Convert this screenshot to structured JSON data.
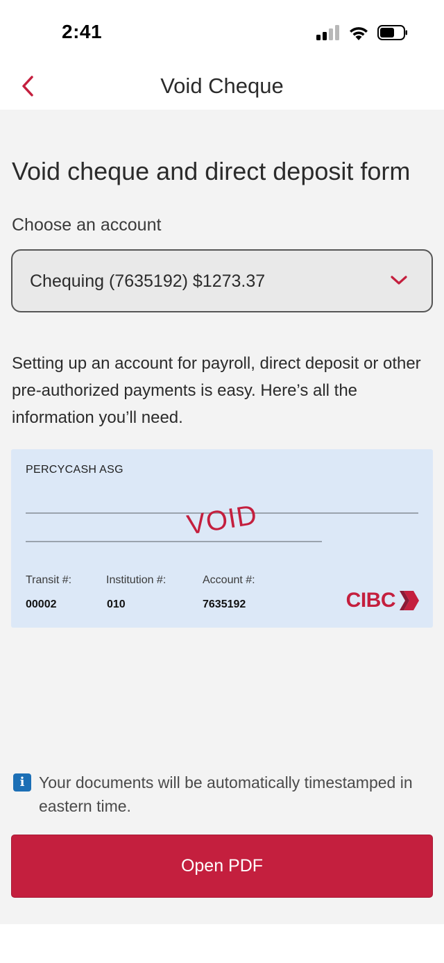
{
  "status_bar": {
    "time": "2:41"
  },
  "nav": {
    "title": "Void Cheque"
  },
  "page": {
    "heading": "Void cheque and direct deposit form",
    "choose_label": "Choose an account",
    "selected_account": "Chequing (7635192) $1273.37",
    "info_text": "Setting up an account for payroll, direct deposit or other pre-authorized payments is easy. Here’s all the information you’ll need."
  },
  "cheque": {
    "holder_name": "PERCYCASH ASG",
    "stamp": "VOID",
    "transit_label": "Transit #:",
    "transit_value": "00002",
    "institution_label": "Institution #:",
    "institution_value": "010",
    "account_label": "Account #:",
    "account_value": "7635192",
    "bank_logo_text": "CIBC"
  },
  "notice": {
    "icon_glyph": "i",
    "text": "Your documents will be automatically timestamped in eastern time."
  },
  "actions": {
    "open_pdf_label": "Open PDF"
  },
  "colors": {
    "brand_red": "#c41f3e",
    "cheque_background": "#dce8f7",
    "info_blue": "#1c6fb5",
    "page_background": "#f3f3f3"
  },
  "icons": {
    "back": "chevron-left-icon",
    "dropdown": "chevron-down-icon",
    "signal": "cellular-signal-icon",
    "wifi": "wifi-icon",
    "battery": "battery-icon",
    "info": "info-icon",
    "bank_logo": "cibc-logo-icon"
  }
}
